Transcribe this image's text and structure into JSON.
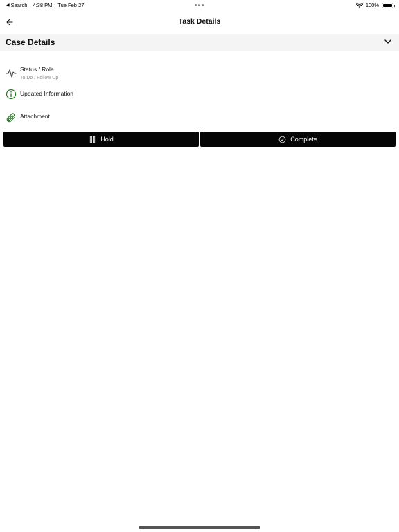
{
  "status_bar": {
    "back_label": "Search",
    "time": "4:38 PM",
    "date": "Tue Feb 27",
    "battery": "100%",
    "battery_level": 1.0
  },
  "nav": {
    "title": "Task Details",
    "back_icon": "arrow-left-icon"
  },
  "section": {
    "title": "Case Details",
    "toggle_icon": "chevron-down-icon"
  },
  "rows": [
    {
      "icon": "activity-icon",
      "title": "Status / Role",
      "subtitle": "To Do / Follow Up"
    },
    {
      "icon": "info-icon",
      "title": "Updated Information"
    },
    {
      "icon": "paperclip-icon",
      "title": "Attachment"
    }
  ],
  "actions": {
    "hold_label": "Hold",
    "hold_icon": "pause-icon",
    "complete_label": "Complete",
    "complete_icon": "check-circle-icon"
  },
  "colors": {
    "accent_green": "#1f7a1f",
    "button_bg": "#050505",
    "section_bg": "#f4f4f4"
  }
}
